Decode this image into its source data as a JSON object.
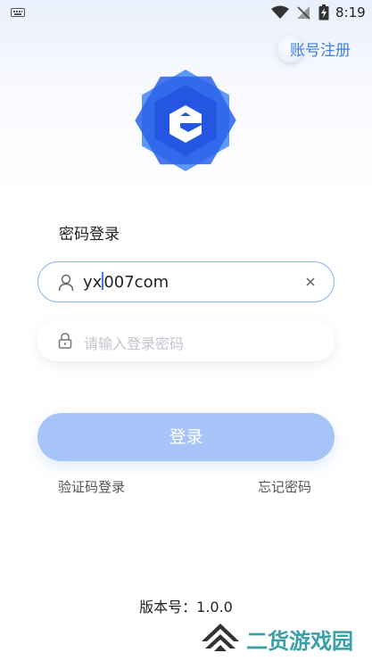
{
  "status_bar": {
    "time": "8:19",
    "icons": [
      "keyboard-icon",
      "wifi-icon",
      "no-signal-icon",
      "battery-charging-icon"
    ]
  },
  "header": {
    "register_label": "账号注册"
  },
  "logo": {
    "icon": "e-hexagon-logo",
    "colors": [
      "#4f8ff5",
      "#1f4fe0",
      "#ffffff"
    ]
  },
  "form": {
    "title": "密码登录",
    "username": {
      "value_before_cursor": "yx",
      "value_after_cursor": "007com",
      "icon": "user-icon",
      "clear_icon": "close-icon"
    },
    "password": {
      "placeholder": "请输入登录密码",
      "icon": "lock-icon"
    },
    "submit_label": "登录",
    "sms_login_label": "验证码登录",
    "forgot_label": "忘记密码"
  },
  "footer": {
    "version": "版本号：1.0.0"
  },
  "watermark": {
    "text": "二货游戏园"
  },
  "colors": {
    "accent": "#3d7de8",
    "button_disabled": "#a6c4f7",
    "input_border": "#8bb3ee"
  }
}
